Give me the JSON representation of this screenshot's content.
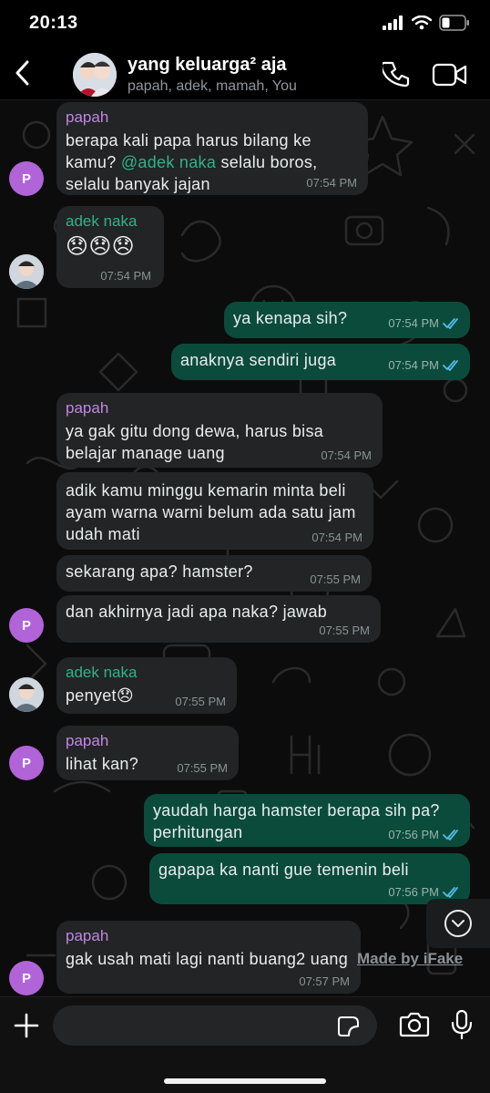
{
  "status_bar": {
    "time": "20:13"
  },
  "header": {
    "back_icon": "chevron-left-icon",
    "title": "yang keluarga² aja",
    "members": "papah, adek, mamah, You",
    "call_icon": "phone-icon",
    "video_icon": "video-camera-icon"
  },
  "messages": [
    {
      "id": 1,
      "direction": "incoming",
      "sender": "papah",
      "text_before": "berapa kali papa harus bilang ke kamu? ",
      "mention": "@adek naka",
      "text_after": " selalu boros, selalu banyak jajan",
      "time": "07:54 PM"
    },
    {
      "id": 2,
      "direction": "incoming",
      "sender": "adek naka",
      "text": "😞😞😞",
      "time": "07:54 PM"
    },
    {
      "id": 3,
      "direction": "outgoing",
      "text": "ya kenapa sih?",
      "time": "07:54 PM",
      "status": "read"
    },
    {
      "id": 4,
      "direction": "outgoing",
      "text": "anaknya sendiri juga",
      "time": "07:54 PM",
      "status": "read"
    },
    {
      "id": 5,
      "direction": "incoming",
      "sender": "papah",
      "text": "ya gak gitu dong dewa, harus bisa belajar manage uang",
      "time": "07:54 PM"
    },
    {
      "id": 6,
      "direction": "incoming",
      "text": "adik kamu minggu kemarin minta beli ayam warna warni belum ada satu jam udah mati",
      "time": "07:54 PM"
    },
    {
      "id": 7,
      "direction": "incoming",
      "text": "sekarang apa? hamster?",
      "time": "07:55 PM"
    },
    {
      "id": 8,
      "direction": "incoming",
      "text": "dan akhirnya jadi apa naka? jawab",
      "time": "07:55 PM"
    },
    {
      "id": 9,
      "direction": "incoming",
      "sender": "adek naka",
      "text": "penyet😞",
      "time": "07:55 PM"
    },
    {
      "id": 10,
      "direction": "incoming",
      "sender": "papah",
      "text": "lihat kan?",
      "time": "07:55 PM"
    },
    {
      "id": 11,
      "direction": "outgoing",
      "text": "yaudah harga hamster berapa sih pa? perhitungan",
      "time": "07:56 PM",
      "status": "read"
    },
    {
      "id": 12,
      "direction": "outgoing",
      "text": "gapapa ka nanti gue temenin beli",
      "time": "07:56 PM",
      "status": "read"
    },
    {
      "id": 13,
      "direction": "incoming",
      "sender": "papah",
      "text": "gak usah mati lagi nanti buang2 uang",
      "time": "07:57 PM"
    }
  ],
  "avatars": {
    "papah_initial": "P"
  },
  "watermark": "Made by iFake",
  "input_bar": {
    "placeholder": "",
    "plus_icon": "plus-icon",
    "sticker_icon": "sticker-icon",
    "camera_icon": "camera-icon",
    "mic_icon": "microphone-icon"
  },
  "colors": {
    "incoming_bubble": "#222425",
    "outgoing_bubble": "#0b4b3b",
    "papah_name": "#c187e0",
    "adek_name": "#2fb38a",
    "read_ticks": "#53bdeb",
    "papah_avatar": "#b163d8"
  }
}
